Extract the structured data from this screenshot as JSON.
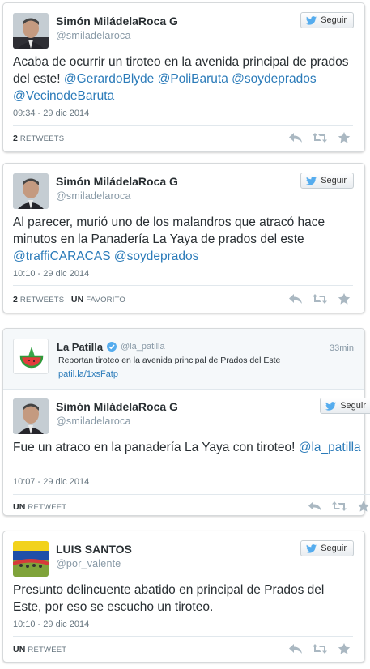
{
  "follow_label": "Seguir",
  "colors": {
    "mention": "#2b7bb9",
    "name": "#292f33",
    "muted": "#8899a6",
    "twitter_blue": "#55acee"
  },
  "tweets": [
    {
      "name": "Simón MiládelaRoca G",
      "handle": "@smiladelaroca",
      "text_parts": [
        {
          "t": "Acaba de ocurrir un tiroteo en la avenida principal de prados del este! "
        },
        {
          "t": "@GerardoBlyde",
          "m": true
        },
        {
          "t": " "
        },
        {
          "t": "@PoliBaruta",
          "m": true
        },
        {
          "t": " "
        },
        {
          "t": "@soydeprados",
          "m": true
        },
        {
          "t": " "
        },
        {
          "t": "@VecinodeBaruta",
          "m": true
        }
      ],
      "time": "09:34 - 29 dic 2014",
      "stat1_num": "2",
      "stat1_label": "RETWEETS",
      "stat2_num": "",
      "stat2_label": ""
    },
    {
      "name": "Simón MiládelaRoca G",
      "handle": "@smiladelaroca",
      "text_parts": [
        {
          "t": "Al parecer, murió uno de los malandros que atracó hace minutos en la Panadería La Yaya de prados del este "
        },
        {
          "t": "@traffiCARACAS",
          "m": true
        },
        {
          "t": " "
        },
        {
          "t": "@soydeprados",
          "m": true
        }
      ],
      "time": "10:10 - 29 dic 2014",
      "stat1_num": "2",
      "stat1_label": "RETWEETS",
      "stat2_num": "UN",
      "stat2_label": "FAVORITO"
    },
    {
      "name": "Simón MiládelaRoca G",
      "handle": "@smiladelaroca",
      "text_parts": [
        {
          "t": "Fue un atraco en la panadería La Yaya con tiroteo! "
        },
        {
          "t": "@la_patilla",
          "m": true
        }
      ],
      "time": "10:07 - 29 dic 2014",
      "stat1_num": "UN",
      "stat1_label": "RETWEET",
      "stat2_num": "",
      "stat2_label": ""
    },
    {
      "name": "LUIS SANTOS",
      "handle": "@por_valente",
      "text_parts": [
        {
          "t": "Presunto delincuente abatido en principal de Prados del Este, por eso se escucho un tiroteo."
        }
      ],
      "time": "10:10 - 29 dic 2014",
      "stat1_num": "UN",
      "stat1_label": "RETWEET",
      "stat2_num": "",
      "stat2_label": ""
    }
  ],
  "quoted": {
    "name": "La Patilla",
    "handle": "@la_patilla",
    "time": "33min",
    "text": "Reportan tiroteo en la avenida principal de Prados del Este",
    "link": "patil.la/1xsFatp"
  }
}
